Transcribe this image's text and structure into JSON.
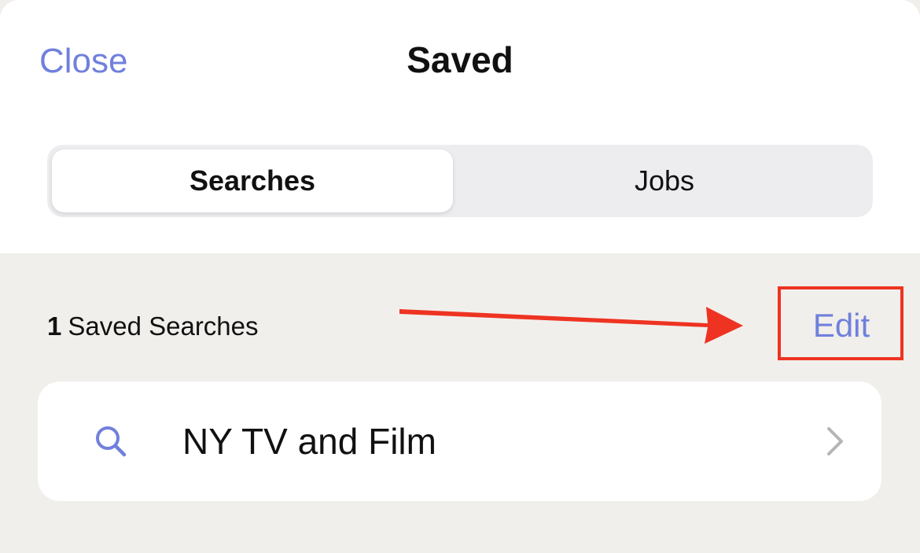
{
  "header": {
    "close_label": "Close",
    "title": "Saved"
  },
  "tabs": [
    {
      "label": "Searches",
      "selected": true
    },
    {
      "label": "Jobs",
      "selected": false
    }
  ],
  "saved_searches": {
    "count": "1",
    "count_label": "Saved Searches",
    "edit_label": "Edit",
    "items": [
      {
        "label": "NY TV and Film",
        "icon": "search-icon",
        "trailing_icon": "chevron-right-icon"
      }
    ]
  },
  "colors": {
    "accent": "#7080dd",
    "annotation": "#ee3322",
    "background": "#f1efeb"
  }
}
